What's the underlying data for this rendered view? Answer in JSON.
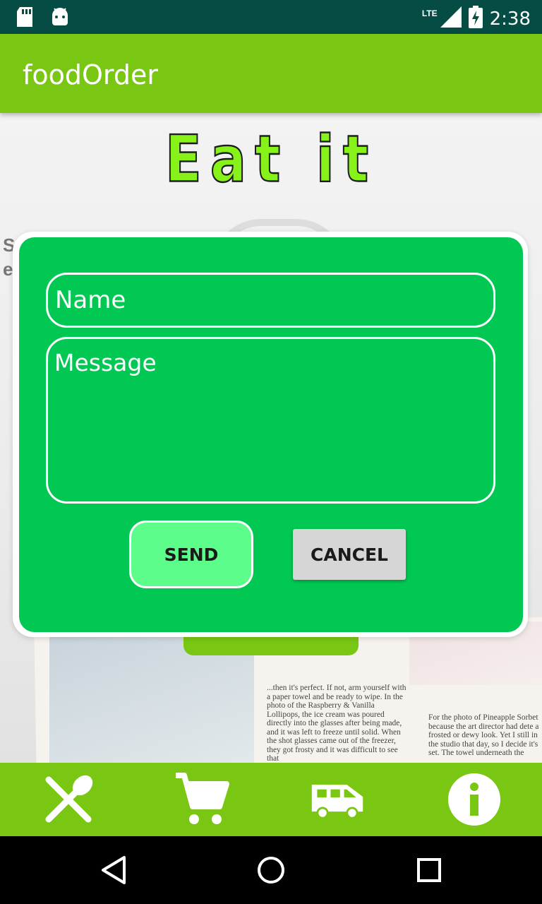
{
  "status_bar": {
    "time": "2:38",
    "network": "LTE",
    "icons": [
      "sd-card-icon",
      "android-icon",
      "lte-signal-icon",
      "battery-charging-icon"
    ]
  },
  "app_bar": {
    "title": "foodOrder"
  },
  "logo": {
    "text": "Eat it",
    "color": "#86f21a"
  },
  "background": {
    "partial_text_line1": "S",
    "partial_text_line2": "e",
    "magazine_text_1": "...then it's perfect. If not, arm yourself with a paper towel and be ready to wipe. In the photo of the Raspberry & Vanilla Lollipops, the ice cream was poured directly into the glasses after being made, and it was left to freeze until solid. When the shot glasses came out of the freezer, they got frosty and it was difficult to see that",
    "magazine_text_2": "For the photo of Pineapple Sorbet because the art director had dete a frosted or dewy look. Yet I still in the studio that day, so I decide it's set. The towel underneath the"
  },
  "dialog": {
    "name_placeholder": "Name",
    "message_placeholder": "Message",
    "send_label": "SEND",
    "cancel_label": "CANCEL"
  },
  "bottom_nav": {
    "items": [
      {
        "icon": "fork-spoon-icon"
      },
      {
        "icon": "cart-icon"
      },
      {
        "icon": "delivery-van-icon"
      },
      {
        "icon": "info-icon"
      }
    ]
  },
  "system_nav": {
    "icons": [
      "back-icon",
      "home-icon",
      "recents-icon"
    ]
  },
  "colors": {
    "status_bar": "#054d44",
    "app_bar": "#79c713",
    "dialog": "#00c853",
    "send_button": "#5cfd8a",
    "cancel_button": "#d6d6d6"
  }
}
